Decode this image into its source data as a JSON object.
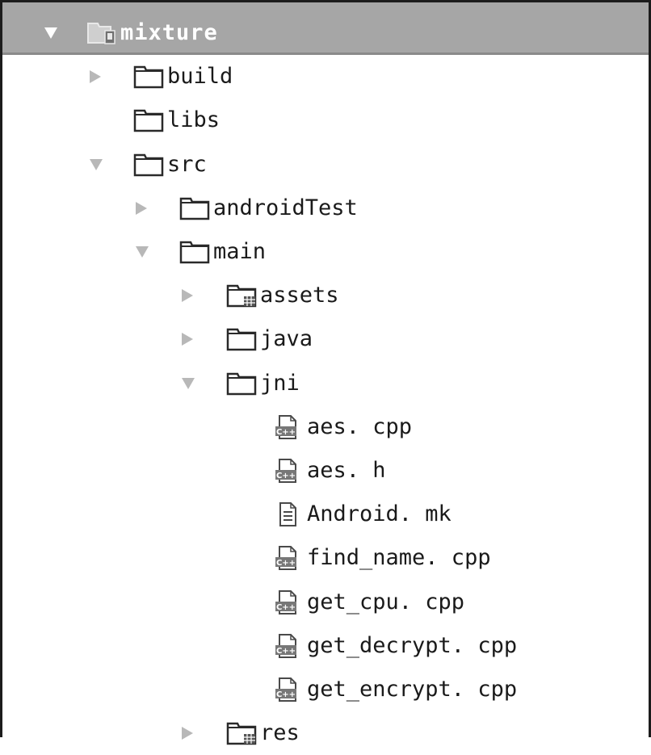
{
  "tree": {
    "nodes": [
      {
        "label": "mixture",
        "icon": "module-icon",
        "state": "expanded",
        "depth": 0,
        "selected": true
      },
      {
        "label": "build",
        "icon": "folder-icon",
        "state": "collapsed",
        "depth": 1
      },
      {
        "label": "libs",
        "icon": "folder-icon",
        "state": "none",
        "depth": 1
      },
      {
        "label": "src",
        "icon": "folder-icon",
        "state": "expanded",
        "depth": 1
      },
      {
        "label": "androidTest",
        "icon": "folder-icon",
        "state": "collapsed",
        "depth": 2
      },
      {
        "label": "main",
        "icon": "folder-icon",
        "state": "expanded",
        "depth": 2
      },
      {
        "label": "assets",
        "icon": "resource-folder-icon",
        "state": "collapsed",
        "depth": 3
      },
      {
        "label": "java",
        "icon": "folder-icon",
        "state": "collapsed",
        "depth": 3
      },
      {
        "label": "jni",
        "icon": "folder-icon",
        "state": "expanded",
        "depth": 3
      },
      {
        "label": "aes. cpp",
        "icon": "cpp-file-icon",
        "state": "none",
        "depth": 4
      },
      {
        "label": "aes. h",
        "icon": "cpp-file-icon",
        "state": "none",
        "depth": 4
      },
      {
        "label": "Android. mk",
        "icon": "text-file-icon",
        "state": "none",
        "depth": 4
      },
      {
        "label": "find_name. cpp",
        "icon": "cpp-file-icon",
        "state": "none",
        "depth": 4
      },
      {
        "label": "get_cpu. cpp",
        "icon": "cpp-file-icon",
        "state": "none",
        "depth": 4
      },
      {
        "label": "get_decrypt. cpp",
        "icon": "cpp-file-icon",
        "state": "none",
        "depth": 4
      },
      {
        "label": "get_encrypt. cpp",
        "icon": "cpp-file-icon",
        "state": "none",
        "depth": 4
      },
      {
        "label": "res",
        "icon": "resource-folder-icon",
        "state": "collapsed",
        "depth": 3
      }
    ]
  },
  "colors": {
    "selection": "#a6a6a6",
    "arrow": "#b8b8b8",
    "text": "#1a1a1a",
    "border": "#1c1c1c"
  }
}
